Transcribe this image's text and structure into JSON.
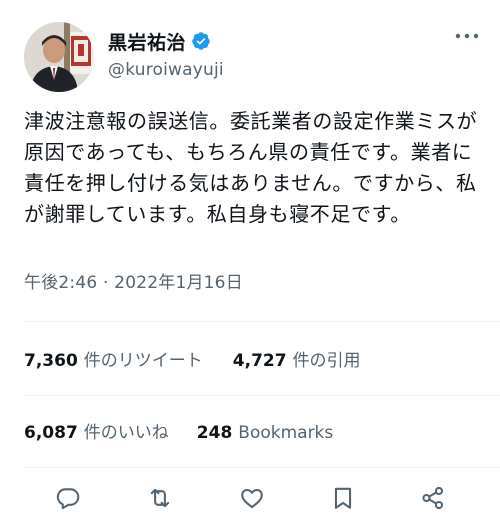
{
  "user": {
    "display_name": "黒岩祐治",
    "handle": "@kuroiwayuji",
    "verified": true
  },
  "tweet": {
    "text": "津波注意報の誤送信。委託業者の設定作業ミスが原因であっても、もちろん県の責任です。業者に責任を押し付ける気はありません。ですから、私が謝罪しています。私自身も寝不足です。",
    "timestamp": "午後2:46 · 2022年1月16日"
  },
  "stats": {
    "retweets_count": "7,360",
    "retweets_label": "件のリツイート",
    "quotes_count": "4,727",
    "quotes_label": "件の引用",
    "likes_count": "6,087",
    "likes_label": "件のいいね",
    "bookmarks_count": "248",
    "bookmarks_label": "Bookmarks"
  },
  "actions": {
    "reply": "reply-icon",
    "retweet": "retweet-icon",
    "like": "heart-icon",
    "bookmark": "bookmark-icon",
    "share": "share-icon"
  },
  "colors": {
    "text": "#0f1419",
    "secondary": "#536471",
    "verified": "#1d9bf0",
    "divider": "#eff3f4"
  }
}
